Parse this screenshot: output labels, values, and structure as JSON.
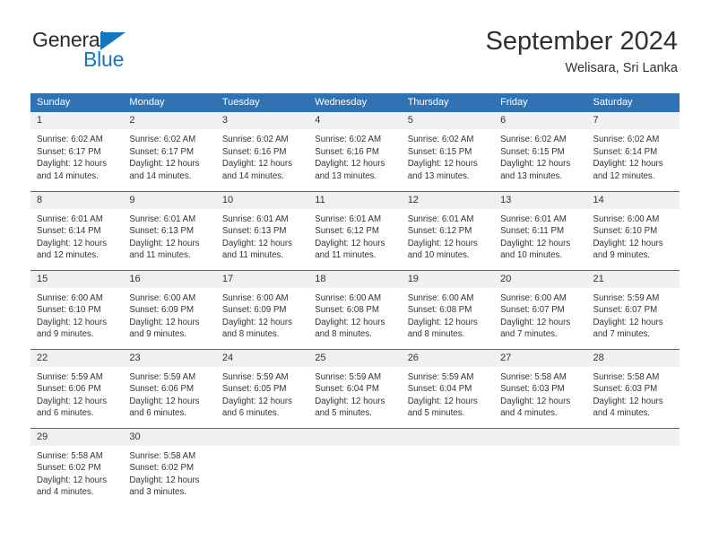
{
  "brand": {
    "name_top": "General",
    "name_bottom": "Blue",
    "triangle_color": "#1277bf"
  },
  "header": {
    "title": "September 2024",
    "subtitle": "Welisara, Sri Lanka"
  },
  "theme": {
    "header_blue": "#3073b5",
    "divider_blue": "#2e6da8",
    "daynum_bg": "#f0f0f0",
    "text": "#333333"
  },
  "columns": [
    "Sunday",
    "Monday",
    "Tuesday",
    "Wednesday",
    "Thursday",
    "Friday",
    "Saturday"
  ],
  "weeks": [
    [
      {
        "day": "1",
        "sunrise": "Sunrise: 6:02 AM",
        "sunset": "Sunset: 6:17 PM",
        "daylight_1": "Daylight: 12 hours",
        "daylight_2": "and 14 minutes."
      },
      {
        "day": "2",
        "sunrise": "Sunrise: 6:02 AM",
        "sunset": "Sunset: 6:17 PM",
        "daylight_1": "Daylight: 12 hours",
        "daylight_2": "and 14 minutes."
      },
      {
        "day": "3",
        "sunrise": "Sunrise: 6:02 AM",
        "sunset": "Sunset: 6:16 PM",
        "daylight_1": "Daylight: 12 hours",
        "daylight_2": "and 14 minutes."
      },
      {
        "day": "4",
        "sunrise": "Sunrise: 6:02 AM",
        "sunset": "Sunset: 6:16 PM",
        "daylight_1": "Daylight: 12 hours",
        "daylight_2": "and 13 minutes."
      },
      {
        "day": "5",
        "sunrise": "Sunrise: 6:02 AM",
        "sunset": "Sunset: 6:15 PM",
        "daylight_1": "Daylight: 12 hours",
        "daylight_2": "and 13 minutes."
      },
      {
        "day": "6",
        "sunrise": "Sunrise: 6:02 AM",
        "sunset": "Sunset: 6:15 PM",
        "daylight_1": "Daylight: 12 hours",
        "daylight_2": "and 13 minutes."
      },
      {
        "day": "7",
        "sunrise": "Sunrise: 6:02 AM",
        "sunset": "Sunset: 6:14 PM",
        "daylight_1": "Daylight: 12 hours",
        "daylight_2": "and 12 minutes."
      }
    ],
    [
      {
        "day": "8",
        "sunrise": "Sunrise: 6:01 AM",
        "sunset": "Sunset: 6:14 PM",
        "daylight_1": "Daylight: 12 hours",
        "daylight_2": "and 12 minutes."
      },
      {
        "day": "9",
        "sunrise": "Sunrise: 6:01 AM",
        "sunset": "Sunset: 6:13 PM",
        "daylight_1": "Daylight: 12 hours",
        "daylight_2": "and 11 minutes."
      },
      {
        "day": "10",
        "sunrise": "Sunrise: 6:01 AM",
        "sunset": "Sunset: 6:13 PM",
        "daylight_1": "Daylight: 12 hours",
        "daylight_2": "and 11 minutes."
      },
      {
        "day": "11",
        "sunrise": "Sunrise: 6:01 AM",
        "sunset": "Sunset: 6:12 PM",
        "daylight_1": "Daylight: 12 hours",
        "daylight_2": "and 11 minutes."
      },
      {
        "day": "12",
        "sunrise": "Sunrise: 6:01 AM",
        "sunset": "Sunset: 6:12 PM",
        "daylight_1": "Daylight: 12 hours",
        "daylight_2": "and 10 minutes."
      },
      {
        "day": "13",
        "sunrise": "Sunrise: 6:01 AM",
        "sunset": "Sunset: 6:11 PM",
        "daylight_1": "Daylight: 12 hours",
        "daylight_2": "and 10 minutes."
      },
      {
        "day": "14",
        "sunrise": "Sunrise: 6:00 AM",
        "sunset": "Sunset: 6:10 PM",
        "daylight_1": "Daylight: 12 hours",
        "daylight_2": "and 9 minutes."
      }
    ],
    [
      {
        "day": "15",
        "sunrise": "Sunrise: 6:00 AM",
        "sunset": "Sunset: 6:10 PM",
        "daylight_1": "Daylight: 12 hours",
        "daylight_2": "and 9 minutes."
      },
      {
        "day": "16",
        "sunrise": "Sunrise: 6:00 AM",
        "sunset": "Sunset: 6:09 PM",
        "daylight_1": "Daylight: 12 hours",
        "daylight_2": "and 9 minutes."
      },
      {
        "day": "17",
        "sunrise": "Sunrise: 6:00 AM",
        "sunset": "Sunset: 6:09 PM",
        "daylight_1": "Daylight: 12 hours",
        "daylight_2": "and 8 minutes."
      },
      {
        "day": "18",
        "sunrise": "Sunrise: 6:00 AM",
        "sunset": "Sunset: 6:08 PM",
        "daylight_1": "Daylight: 12 hours",
        "daylight_2": "and 8 minutes."
      },
      {
        "day": "19",
        "sunrise": "Sunrise: 6:00 AM",
        "sunset": "Sunset: 6:08 PM",
        "daylight_1": "Daylight: 12 hours",
        "daylight_2": "and 8 minutes."
      },
      {
        "day": "20",
        "sunrise": "Sunrise: 6:00 AM",
        "sunset": "Sunset: 6:07 PM",
        "daylight_1": "Daylight: 12 hours",
        "daylight_2": "and 7 minutes."
      },
      {
        "day": "21",
        "sunrise": "Sunrise: 5:59 AM",
        "sunset": "Sunset: 6:07 PM",
        "daylight_1": "Daylight: 12 hours",
        "daylight_2": "and 7 minutes."
      }
    ],
    [
      {
        "day": "22",
        "sunrise": "Sunrise: 5:59 AM",
        "sunset": "Sunset: 6:06 PM",
        "daylight_1": "Daylight: 12 hours",
        "daylight_2": "and 6 minutes."
      },
      {
        "day": "23",
        "sunrise": "Sunrise: 5:59 AM",
        "sunset": "Sunset: 6:06 PM",
        "daylight_1": "Daylight: 12 hours",
        "daylight_2": "and 6 minutes."
      },
      {
        "day": "24",
        "sunrise": "Sunrise: 5:59 AM",
        "sunset": "Sunset: 6:05 PM",
        "daylight_1": "Daylight: 12 hours",
        "daylight_2": "and 6 minutes."
      },
      {
        "day": "25",
        "sunrise": "Sunrise: 5:59 AM",
        "sunset": "Sunset: 6:04 PM",
        "daylight_1": "Daylight: 12 hours",
        "daylight_2": "and 5 minutes."
      },
      {
        "day": "26",
        "sunrise": "Sunrise: 5:59 AM",
        "sunset": "Sunset: 6:04 PM",
        "daylight_1": "Daylight: 12 hours",
        "daylight_2": "and 5 minutes."
      },
      {
        "day": "27",
        "sunrise": "Sunrise: 5:58 AM",
        "sunset": "Sunset: 6:03 PM",
        "daylight_1": "Daylight: 12 hours",
        "daylight_2": "and 4 minutes."
      },
      {
        "day": "28",
        "sunrise": "Sunrise: 5:58 AM",
        "sunset": "Sunset: 6:03 PM",
        "daylight_1": "Daylight: 12 hours",
        "daylight_2": "and 4 minutes."
      }
    ],
    [
      {
        "day": "29",
        "sunrise": "Sunrise: 5:58 AM",
        "sunset": "Sunset: 6:02 PM",
        "daylight_1": "Daylight: 12 hours",
        "daylight_2": "and 4 minutes."
      },
      {
        "day": "30",
        "sunrise": "Sunrise: 5:58 AM",
        "sunset": "Sunset: 6:02 PM",
        "daylight_1": "Daylight: 12 hours",
        "daylight_2": "and 3 minutes."
      },
      {
        "day": "",
        "sunrise": "",
        "sunset": "",
        "daylight_1": "",
        "daylight_2": ""
      },
      {
        "day": "",
        "sunrise": "",
        "sunset": "",
        "daylight_1": "",
        "daylight_2": ""
      },
      {
        "day": "",
        "sunrise": "",
        "sunset": "",
        "daylight_1": "",
        "daylight_2": ""
      },
      {
        "day": "",
        "sunrise": "",
        "sunset": "",
        "daylight_1": "",
        "daylight_2": ""
      },
      {
        "day": "",
        "sunrise": "",
        "sunset": "",
        "daylight_1": "",
        "daylight_2": ""
      }
    ]
  ]
}
